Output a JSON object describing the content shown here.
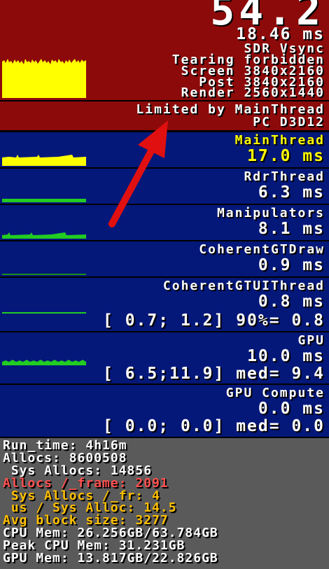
{
  "header": {
    "fps": "54.2",
    "frame_time": "18.46 ms",
    "vsync": "SDR Vsync",
    "tearing": "Tearing forbidden",
    "screen": "Screen 3840x2160",
    "post": "Post 3840x2160",
    "render": "Render 2560x1440"
  },
  "limit": {
    "line1": "Limited by MainThread",
    "line2": "PC D3D12"
  },
  "threads": [
    {
      "name": "MainThread",
      "time": "17.0 ms"
    },
    {
      "name": "RdrThread",
      "time": "6.3 ms"
    },
    {
      "name": "Manipulators",
      "time": "8.1 ms"
    },
    {
      "name": "CoherentGTDraw",
      "time": "0.9 ms"
    },
    {
      "name": "CoherentGTUIThread",
      "time": "0.8 ms",
      "range": "[ 0.7; 1.2] 90%= 0.8"
    },
    {
      "name": "GPU",
      "time": "10.0 ms",
      "range": "[ 6.5;11.9] med= 9.4"
    },
    {
      "name": "GPU Compute",
      "time": "0.0 ms",
      "range": "[ 0.0; 0.0] med= 0.0"
    }
  ],
  "stats": {
    "run_time": "Run_time: 4h16m",
    "allocs": "Allocs: 8600508",
    "sys_allocs": " Sys Allocs: 14856",
    "allocs_frame": "Allocs /_frame: 2091",
    "sys_allocs_fr": " Sys Allocs /_fr: 4",
    "us_sys_alloc": " us / Sys Alloc: 14.5",
    "avg_block": "Avg block size: 3277",
    "cpu_mem": "CPU Mem: 26.256GB/63.784GB",
    "peak_cpu": "Peak CPU Mem: 31.231GB",
    "gpu_mem": "GPU Mem: 13.817GB/22.826GB"
  },
  "colors": {
    "panel_red": "#8c0a0a",
    "panel_blue": "#04187a",
    "stats_gray": "#5a5a5a",
    "highlight_yellow": "#ffff00",
    "graph_green": "#22cc22",
    "alert_red": "#ff5050",
    "warn_orange": "#ffc000",
    "arrow_red": "#e01010"
  }
}
